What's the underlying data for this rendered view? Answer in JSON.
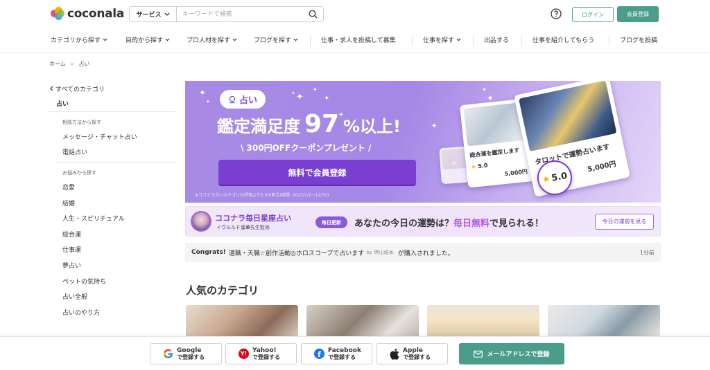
{
  "header": {
    "logo_text": "coconala",
    "search": {
      "category": "サービス",
      "placeholder": "キーワードで検索"
    },
    "login_label": "ログイン",
    "register_label": "会員登録"
  },
  "nav": {
    "items": [
      {
        "label": "カテゴリから探す",
        "has_chevron": true
      },
      {
        "label": "目的から探す",
        "has_chevron": true
      },
      {
        "label": "プロ人材を探す",
        "has_chevron": true
      },
      {
        "label": "ブログを探す",
        "has_chevron": true
      },
      {
        "label": "仕事・求人を投稿して募集",
        "has_chevron": false
      },
      {
        "label": "仕事を探す",
        "has_chevron": true
      },
      {
        "label": "出品する",
        "has_chevron": false
      },
      {
        "label": "仕事を紹介してもらう",
        "has_chevron": false
      },
      {
        "label": "ブログを投稿",
        "has_chevron": false
      }
    ]
  },
  "breadcrumb": {
    "home": "ホーム",
    "sep": ">",
    "current": "占い"
  },
  "sidebar": {
    "all_categories": "すべてのカテゴリ",
    "current": "占い",
    "group1_title": "相談方法から探す",
    "group1_items": [
      "メッセージ・チャット占い",
      "電話占い"
    ],
    "group2_title": "お悩みから探す",
    "group2_items": [
      "恋愛",
      "結婚",
      "人生・スピリチュアル",
      "総合運",
      "仕事運",
      "夢占い",
      "ペットの気持ち",
      "占い全般",
      "占いのやり方"
    ]
  },
  "banner": {
    "pill": "占い",
    "title_prefix": "鑑定満足度",
    "title_number": "97",
    "title_pct": "%",
    "title_suffix": "以上!",
    "asterisk": "※",
    "subtitle": "\\ 300円OFFクーポンプレゼント /",
    "cta": "無料で会員登録",
    "note": "※ココナラ占いカテゴリの評価より5.0の割合(期間: 2022/1/1〜12/31)",
    "card_small": {
      "label": "総合運を鑑定します",
      "rating": "5.0",
      "price": "5,000円"
    },
    "card_large": {
      "label": "タロットで運勢占います",
      "rating": "5.0",
      "price": "5,000円"
    },
    "badge_rating": "5.0"
  },
  "promo": {
    "title": "ココナラ毎日星座占い",
    "subtitle": "イヴルルド遙華先生監修",
    "badge": "毎日更新",
    "main_prefix": "あなたの今日の運勢は？",
    "main_highlight": "毎日無料",
    "main_suffix": "で見られる！",
    "button": "今日の運勢を見る"
  },
  "activity": {
    "prefix": "Congrats!",
    "text": "適職・天職☆創作活動◎ホロスコープで占います",
    "by": "by",
    "user": "時山結糸",
    "suffix": "が購入されました。",
    "time": "1分前"
  },
  "popular_title": "人気のカテゴリ",
  "social": {
    "google": {
      "name": "Google",
      "action": "で登録する"
    },
    "yahoo": {
      "name": "Yahoo!",
      "action": "で登録する"
    },
    "facebook": {
      "name": "Facebook",
      "action": "で登録する"
    },
    "apple": {
      "name": "Apple",
      "action": "で登録する"
    },
    "mail": "メールアドレスで登録"
  },
  "colors": {
    "brand_green": "#4a9d8a",
    "banner_purple": "#a88ae6",
    "cta_purple": "#7a3fd1",
    "rating_star": "#f0b400"
  }
}
